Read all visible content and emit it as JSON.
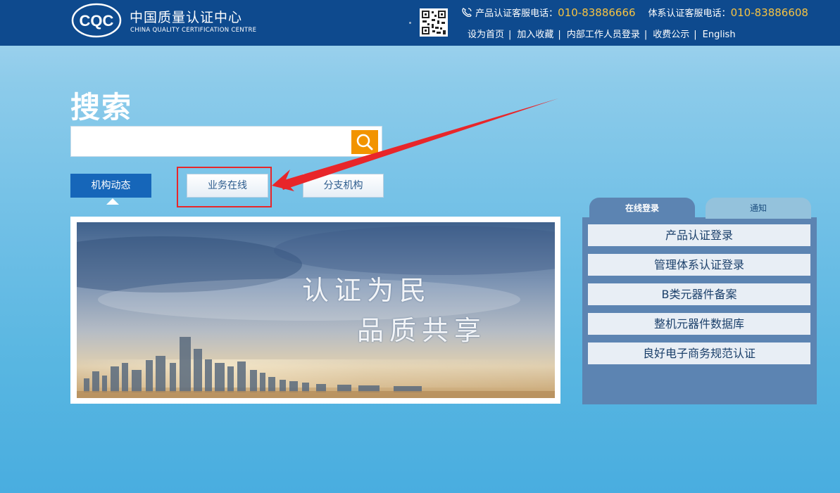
{
  "header": {
    "logo_mark": "CQC",
    "logo_cn": "中国质量认证中心",
    "logo_en": "CHINA QUALITY CERTIFICATION CENTRE",
    "product_hotline_label": "产品认证客服电话：",
    "product_hotline_number": "010-83886666",
    "system_hotline_label": "体系认证客服电话：",
    "system_hotline_number": "010-83886608",
    "links": [
      "设为首页",
      "加入收藏",
      "内部工作人员登录",
      "收费公示",
      "English"
    ],
    "separator": "|"
  },
  "search": {
    "title": "搜索",
    "value": "",
    "placeholder": ""
  },
  "tabs": [
    "机构动态",
    "业务在线",
    "分支机构"
  ],
  "banner": {
    "slogan_line1": "认证为民",
    "slogan_line2": "品质共享"
  },
  "panel": {
    "tabs": [
      "在线登录",
      "通知"
    ],
    "items": [
      "产品认证登录",
      "管理体系认证登录",
      "B类元器件备案",
      "整机元器件数据库",
      "良好电子商务规范认证"
    ]
  },
  "colors": {
    "header_bg": "#0e4a8e",
    "hotline_number": "#f6c343",
    "search_button": "#f29400",
    "active_tab": "#1666b9",
    "panel_bg": "#5c84b2",
    "annotation": "#e8262a"
  },
  "icons": {
    "phone": "phone-icon",
    "search": "search-icon",
    "qr": "qr-code-icon",
    "annotation_arrow": "arrow-icon"
  }
}
